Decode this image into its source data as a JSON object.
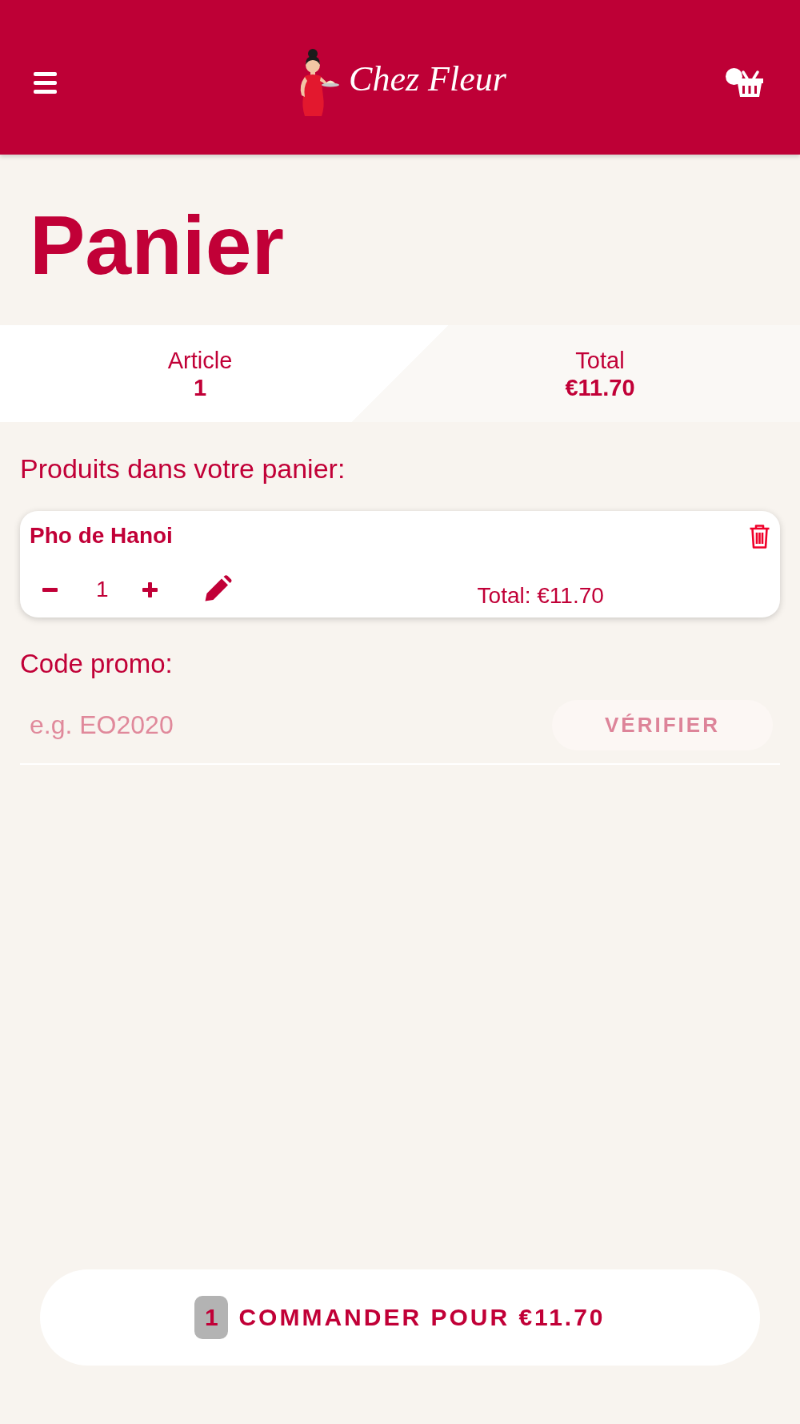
{
  "header": {
    "logo_text": "Chez Fleur"
  },
  "title": "Panier",
  "summary": [
    {
      "label": "Article",
      "value": "1"
    },
    {
      "label": "Total",
      "value": "€11.70"
    }
  ],
  "products_heading": "Produits dans votre panier:",
  "cart_items": [
    {
      "name": "Pho de Hanoi",
      "quantity": "1",
      "total": "Total: €11.70"
    }
  ],
  "promo": {
    "label": "Code promo:",
    "placeholder": "e.g. EO2020",
    "button": {
      "label": "VÉRIFIER",
      "disabled": true
    }
  },
  "checkout": {
    "count": "1",
    "label": "COMMANDER POUR €11.70"
  }
}
